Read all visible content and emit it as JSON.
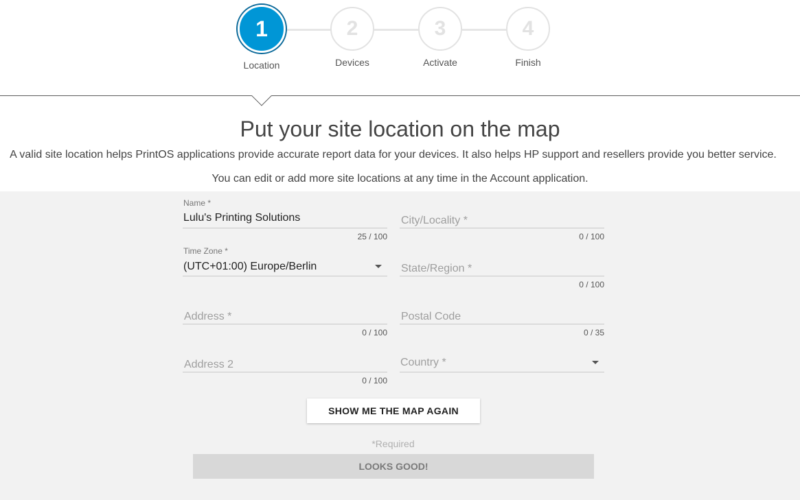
{
  "stepper": {
    "steps": [
      {
        "number": "1",
        "label": "Location"
      },
      {
        "number": "2",
        "label": "Devices"
      },
      {
        "number": "3",
        "label": "Activate"
      },
      {
        "number": "4",
        "label": "Finish"
      }
    ],
    "active_step": 1
  },
  "header": {
    "title": "Put your site location on the map",
    "description": "A valid site location helps PrintOS applications provide accurate report data for your devices. It also helps HP support and resellers provide you better service.",
    "note": "You can edit or add more site locations at any time in the Account application."
  },
  "form": {
    "name": {
      "label": "Name *",
      "value": "Lulu's Printing Solutions",
      "counter": "25 / 100"
    },
    "city": {
      "placeholder": "City/Locality *",
      "counter": "0 / 100"
    },
    "timezone": {
      "label": "Time Zone *",
      "value": "(UTC+01:00) Europe/Berlin"
    },
    "state": {
      "placeholder": "State/Region *",
      "counter": "0 / 100"
    },
    "address": {
      "placeholder": "Address *",
      "counter": "0 / 100"
    },
    "postal": {
      "placeholder": "Postal Code",
      "counter": "0 / 35"
    },
    "address2": {
      "placeholder": "Address 2",
      "counter": "0 / 100"
    },
    "country": {
      "placeholder": "Country *"
    },
    "show_map_label": "SHOW ME THE MAP AGAIN",
    "required_note": "*Required",
    "submit_label": "LOOKS GOOD!"
  },
  "colors": {
    "accent": "#0096d6",
    "panel_bg": "#f2f2f2"
  }
}
